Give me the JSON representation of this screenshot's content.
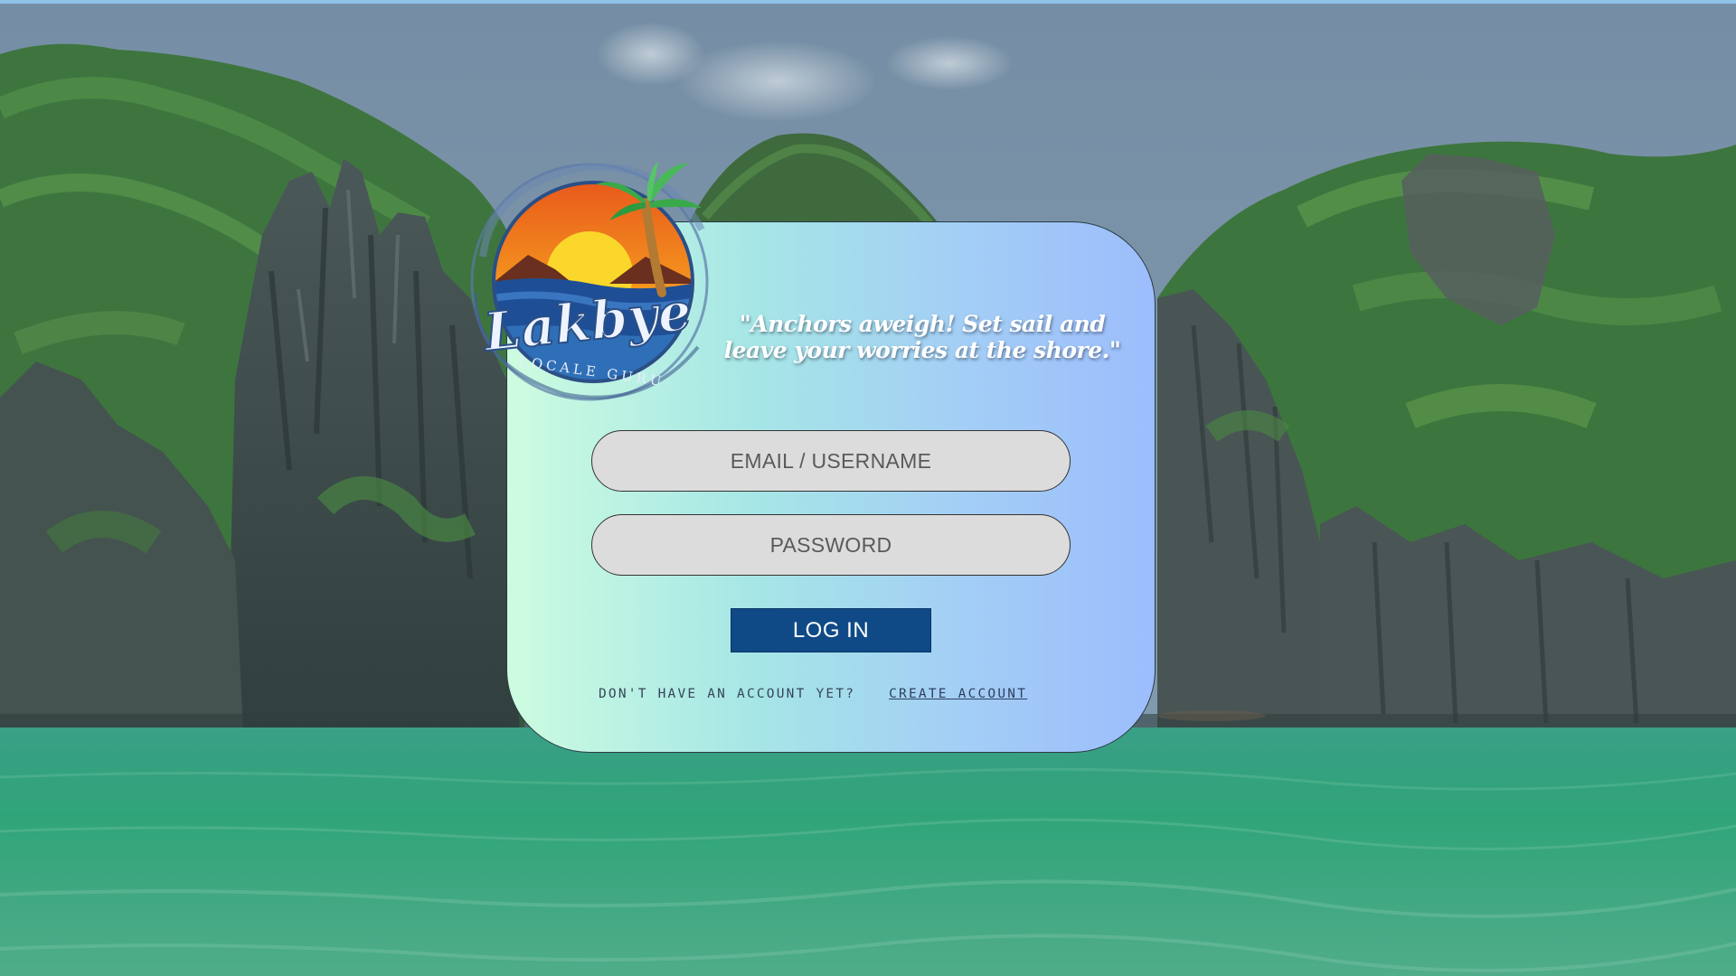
{
  "brand": {
    "name": "Lakbye",
    "tagline": "LOCALE GURU"
  },
  "login": {
    "quote": "\"Anchors aweigh! Set sail and leave your worries at the shore.\"",
    "email_placeholder": "EMAIL / USERNAME",
    "password_placeholder": "PASSWORD",
    "login_button": "LOG IN",
    "no_account_text": "DON'T HAVE AN ACCOUNT YET?",
    "create_account_link": "CREATE ACCOUNT"
  },
  "colors": {
    "button_bg": "#0f4a86",
    "card_gradient_start": "#cdfce0",
    "card_gradient_end": "#9cbdfc",
    "field_bg": "#dcdcdc"
  }
}
